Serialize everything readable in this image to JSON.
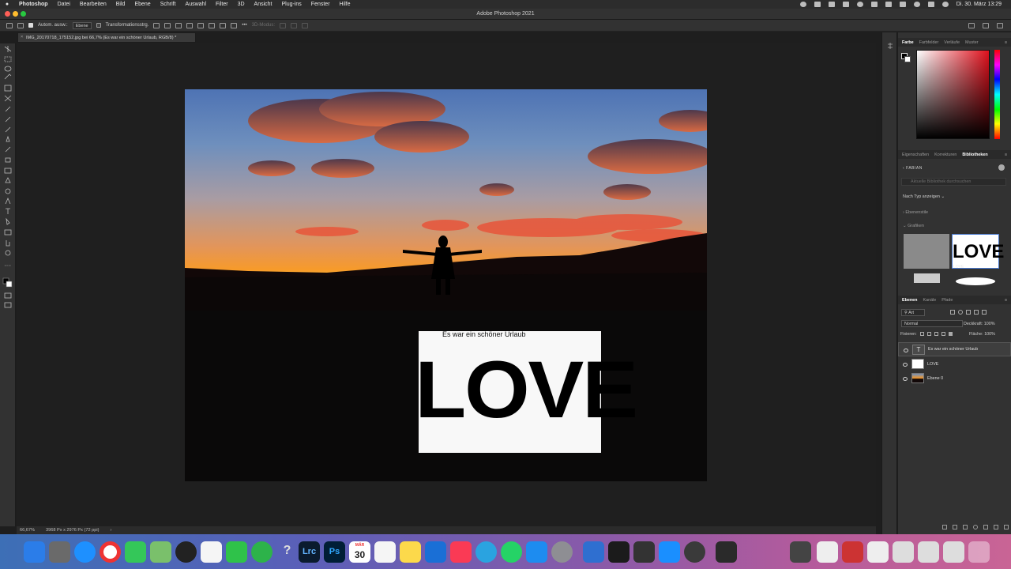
{
  "menubar": {
    "app": "Photoshop",
    "items": [
      "Datei",
      "Bearbeiten",
      "Bild",
      "Ebene",
      "Schrift",
      "Auswahl",
      "Filter",
      "3D",
      "Ansicht",
      "Plug-ins",
      "Fenster",
      "Hilfe"
    ],
    "clock": "Di. 30. März  13:29"
  },
  "window": {
    "title": "Adobe Photoshop 2021"
  },
  "options": {
    "auto_select_label": "Autom. ausw.:",
    "auto_select_value": "Ebene",
    "transform_label": "Transformationsstrg.",
    "mode_3d": "3D-Modus:"
  },
  "document": {
    "tab_title": "IMG_20170718_175152.jpg bei 66,7% (Es war ein schöner Urlaub, RGB/8) *",
    "overlay_subtitle": "Es war ein schöner Urlaub",
    "overlay_word": "LOVE"
  },
  "status": {
    "zoom": "66,67%",
    "size": "3968 Px x 2976 Px (72 ppi)"
  },
  "color_panel": {
    "tabs": [
      "Farbe",
      "Farbfelder",
      "Verläufe",
      "Muster"
    ],
    "active": "Farbe"
  },
  "libraries_panel": {
    "tabs": [
      "Eigenschaften",
      "Korrekturen",
      "Bibliotheken"
    ],
    "active": "Bibliotheken",
    "library_name": "FABIAN",
    "search_placeholder": "Aktuelle Bibliothek durchsuchen",
    "filter": "Nach Typ anzeigen",
    "section_styles": "Ebenenstile",
    "section_graphics": "Grafiken",
    "graphic_love_label": "LOVE",
    "thumb_love": "LOVE"
  },
  "layers_panel": {
    "tabs": [
      "Ebenen",
      "Kanäle",
      "Pfade"
    ],
    "active": "Ebenen",
    "filter": "Art",
    "blend_mode": "Normal",
    "opacity_label": "Deckkraft:",
    "opacity_value": "100%",
    "lock_label": "Fixieren:",
    "fill_label": "Fläche:",
    "fill_value": "100%",
    "layers": [
      {
        "name": "Es war ein schöner Urlaub",
        "type": "text",
        "selected": true
      },
      {
        "name": "LOVE",
        "type": "smart",
        "selected": false
      },
      {
        "name": "Ebene 0",
        "type": "image",
        "selected": false
      }
    ]
  },
  "dock": {
    "lrc_label": "Lrc",
    "ps_label": "Ps",
    "calendar_month": "MÄR",
    "calendar_day": "30"
  }
}
